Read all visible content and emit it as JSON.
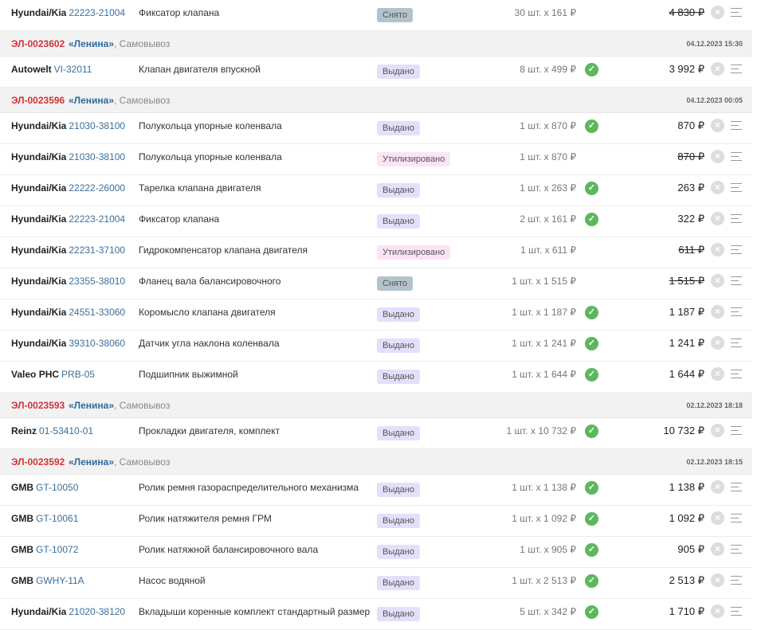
{
  "currency": "₽",
  "groups": [
    {
      "header": null,
      "items": [
        {
          "brand": "Hyundai/Kia",
          "code": "22223-21004",
          "name": "Фиксатор клапана",
          "status": "Снято",
          "qty": "30 шт. x 161 ₽",
          "checked": false,
          "total": "4 830 ₽",
          "struck": true
        }
      ]
    },
    {
      "header": {
        "number": "ЭЛ-0023602",
        "store": "«Ленина»",
        "delivery": ", Самовывоз",
        "date": "04.12.2023 15:30"
      },
      "items": [
        {
          "brand": "Autowelt",
          "code": "VI-32011",
          "name": "Клапан двигателя впускной",
          "status": "Выдано",
          "qty": "8 шт. x 499 ₽",
          "checked": true,
          "total": "3 992 ₽",
          "struck": false
        }
      ]
    },
    {
      "header": {
        "number": "ЭЛ-0023596",
        "store": "«Ленина»",
        "delivery": ", Самовывоз",
        "date": "04.12.2023 00:05"
      },
      "items": [
        {
          "brand": "Hyundai/Kia",
          "code": "21030-38100",
          "name": "Полукольца упорные коленвала",
          "status": "Выдано",
          "qty": "1 шт. x 870 ₽",
          "checked": true,
          "total": "870 ₽",
          "struck": false
        },
        {
          "brand": "Hyundai/Kia",
          "code": "21030-38100",
          "name": "Полукольца упорные коленвала",
          "status": "Утилизировано",
          "qty": "1 шт. x 870 ₽",
          "checked": false,
          "total": "870 ₽",
          "struck": true
        },
        {
          "brand": "Hyundai/Kia",
          "code": "22222-26000",
          "name": "Тарелка клапана двигателя",
          "status": "Выдано",
          "qty": "1 шт. x 263 ₽",
          "checked": true,
          "total": "263 ₽",
          "struck": false
        },
        {
          "brand": "Hyundai/Kia",
          "code": "22223-21004",
          "name": "Фиксатор клапана",
          "status": "Выдано",
          "qty": "2 шт. x 161 ₽",
          "checked": true,
          "total": "322 ₽",
          "struck": false
        },
        {
          "brand": "Hyundai/Kia",
          "code": "22231-37100",
          "name": "Гидрокомпенсатор клапана двигателя",
          "status": "Утилизировано",
          "qty": "1 шт. x 611 ₽",
          "checked": false,
          "total": "611 ₽",
          "struck": true
        },
        {
          "brand": "Hyundai/Kia",
          "code": "23355-38010",
          "name": "Фланец вала балансировочного",
          "status": "Снято",
          "qty": "1 шт. x 1 515 ₽",
          "checked": false,
          "total": "1 515 ₽",
          "struck": true
        },
        {
          "brand": "Hyundai/Kia",
          "code": "24551-33060",
          "name": "Коромысло клапана двигателя",
          "status": "Выдано",
          "qty": "1 шт. x 1 187 ₽",
          "checked": true,
          "total": "1 187 ₽",
          "struck": false
        },
        {
          "brand": "Hyundai/Kia",
          "code": "39310-38060",
          "name": "Датчик угла наклона коленвала",
          "status": "Выдано",
          "qty": "1 шт. x 1 241 ₽",
          "checked": true,
          "total": "1 241 ₽",
          "struck": false
        },
        {
          "brand": "Valeo PHC",
          "code": "PRB-05",
          "name": "Подшипник выжимной",
          "status": "Выдано",
          "qty": "1 шт. x 1 644 ₽",
          "checked": true,
          "total": "1 644 ₽",
          "struck": false
        }
      ]
    },
    {
      "header": {
        "number": "ЭЛ-0023593",
        "store": "«Ленина»",
        "delivery": ", Самовывоз",
        "date": "02.12.2023 18:18"
      },
      "items": [
        {
          "brand": "Reinz",
          "code": "01-53410-01",
          "name": "Прокладки двигателя, комплект",
          "status": "Выдано",
          "qty": "1 шт. x 10 732 ₽",
          "checked": true,
          "total": "10 732 ₽",
          "struck": false
        }
      ]
    },
    {
      "header": {
        "number": "ЭЛ-0023592",
        "store": "«Ленина»",
        "delivery": ", Самовывоз",
        "date": "02.12.2023 18:15"
      },
      "items": [
        {
          "brand": "GMB",
          "code": "GT-10050",
          "name": "Ролик ремня газораспределительного механизма",
          "status": "Выдано",
          "qty": "1 шт. x 1 138 ₽",
          "checked": true,
          "total": "1 138 ₽",
          "struck": false
        },
        {
          "brand": "GMB",
          "code": "GT-10061",
          "name": "Ролик натяжителя ремня ГРМ",
          "status": "Выдано",
          "qty": "1 шт. x 1 092 ₽",
          "checked": true,
          "total": "1 092 ₽",
          "struck": false
        },
        {
          "brand": "GMB",
          "code": "GT-10072",
          "name": "Ролик натяжной балансировочного вала",
          "status": "Выдано",
          "qty": "1 шт. x 905 ₽",
          "checked": true,
          "total": "905 ₽",
          "struck": false
        },
        {
          "brand": "GMB",
          "code": "GWHY-11A",
          "name": "Насос водяной",
          "status": "Выдано",
          "qty": "1 шт. x 2 513 ₽",
          "checked": true,
          "total": "2 513 ₽",
          "struck": false
        },
        {
          "brand": "Hyundai/Kia",
          "code": "21020-38120",
          "name": "Вкладыши коренные комплект стандартный размер",
          "status": "Выдано",
          "qty": "5 шт. x 342 ₽",
          "checked": true,
          "total": "1 710 ₽",
          "struck": false
        }
      ]
    }
  ],
  "icons": {
    "check": "check-circle-icon",
    "remove": "close-circle-icon",
    "menu": "menu-icon"
  }
}
